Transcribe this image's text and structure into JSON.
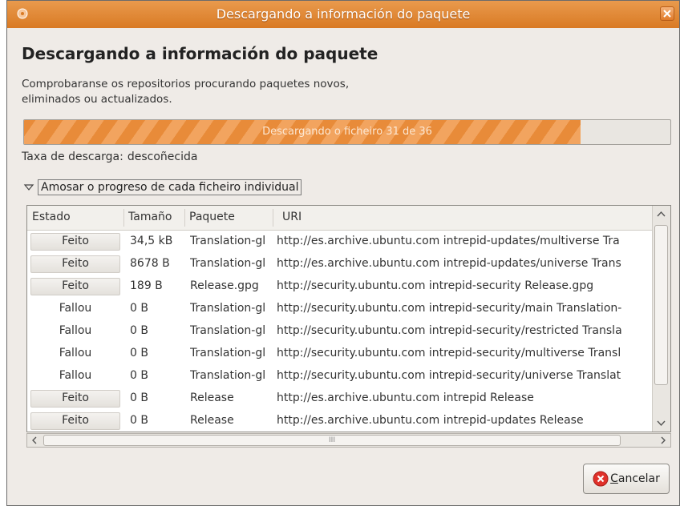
{
  "window": {
    "title": "Descargando a información do paquete"
  },
  "heading": "Descargando a información do paquete",
  "description": "Comprobaranse os repositorios procurando paquetes novos, eliminados ou actualizados.",
  "progress": {
    "label": "Descargando o ficheiro 31 de 36",
    "fraction": 0.8611
  },
  "rate": {
    "label": "Taxa de descarga:",
    "value": "descoñecida"
  },
  "expander": {
    "label": "Amosar o progreso de cada ficheiro individual",
    "expanded": true
  },
  "table": {
    "columns": [
      "Estado",
      "Tamaño",
      "Paquete",
      "URI"
    ],
    "rows": [
      {
        "estado": "Feito",
        "tamano": "34,5 kB",
        "paquete": "Translation-gl",
        "uri": "http://es.archive.ubuntu.com intrepid-updates/multiverse Tra"
      },
      {
        "estado": "Feito",
        "tamano": "8678 B",
        "paquete": "Translation-gl",
        "uri": "http://es.archive.ubuntu.com intrepid-updates/universe Trans"
      },
      {
        "estado": "Feito",
        "tamano": "189 B",
        "paquete": "Release.gpg",
        "uri": "http://security.ubuntu.com intrepid-security Release.gpg"
      },
      {
        "estado": "Fallou",
        "tamano": "0 B",
        "paquete": "Translation-gl",
        "uri": "http://security.ubuntu.com intrepid-security/main Translation-"
      },
      {
        "estado": "Fallou",
        "tamano": "0 B",
        "paquete": "Translation-gl",
        "uri": "http://security.ubuntu.com intrepid-security/restricted Transla"
      },
      {
        "estado": "Fallou",
        "tamano": "0 B",
        "paquete": "Translation-gl",
        "uri": "http://security.ubuntu.com intrepid-security/multiverse Transl"
      },
      {
        "estado": "Fallou",
        "tamano": "0 B",
        "paquete": "Translation-gl",
        "uri": "http://security.ubuntu.com intrepid-security/universe Translat"
      },
      {
        "estado": "Feito",
        "tamano": "0 B",
        "paquete": "Release",
        "uri": "http://es.archive.ubuntu.com intrepid Release"
      },
      {
        "estado": "Feito",
        "tamano": "0 B",
        "paquete": "Release",
        "uri": "http://es.archive.ubuntu.com intrepid-updates Release"
      }
    ]
  },
  "hscroll": {
    "grip": "III"
  },
  "cancel_button": {
    "label": "Cancelar"
  },
  "colors": {
    "accent": "#e88b39",
    "titlebar": "#d97a24",
    "cancel_icon": "#e0312a"
  },
  "icons": [
    "app-icon",
    "close-icon",
    "expander-arrow-icon",
    "scroll-up-icon",
    "scroll-down-icon",
    "scroll-left-icon",
    "scroll-right-icon",
    "cancel-icon"
  ]
}
